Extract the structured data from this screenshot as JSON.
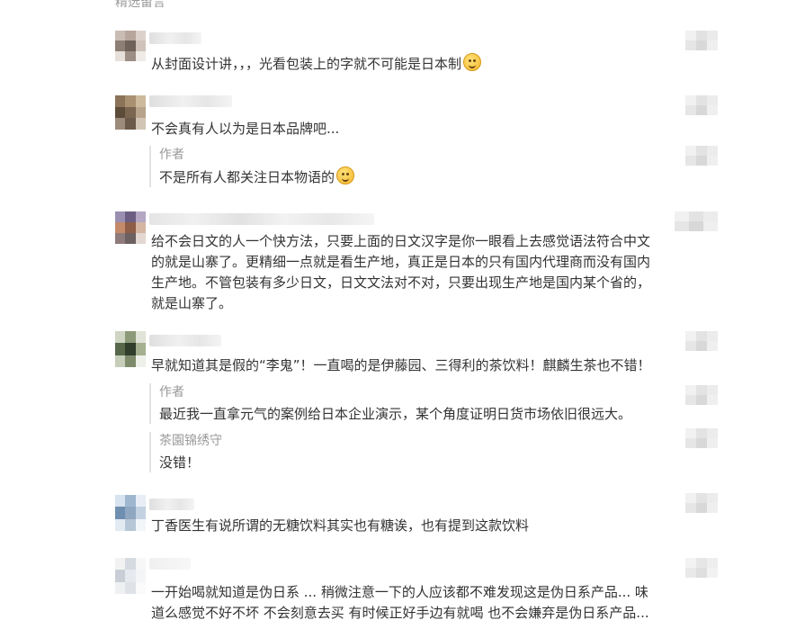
{
  "section": {
    "title": "精选留言"
  },
  "comments": [
    {
      "text": "从封面设计讲，，，光看包装上的字就不可能是日本制",
      "emoji": "smile-icon",
      "replies": []
    },
    {
      "text": "不会真有人以为是日本品牌吧...",
      "replies": [
        {
          "author": "作者",
          "text": "不是所有人都关注日本物语的",
          "emoji": "smile-icon"
        }
      ]
    },
    {
      "text": "给不会日文的人一个快方法，只要上面的日文汉字是你一眼看上去感觉语法符合中文\n的就是山寨了。更精细一点就是看生产地，真正是日本的只有国内代理商而没有国内\n生产地。不管包装有多少日文，日文文法对不对，只要出现生产地是国内某个省的，\n就是山寨了。",
      "replies": []
    },
    {
      "text": "早就知道其是假的“李鬼”！一直喝的是伊藤园、三得利的茶饮料！麒麟生茶也不错！",
      "replies": [
        {
          "author": "作者",
          "text": "最近我一直拿元气的案例给日本企业演示，某个角度证明日货市场依旧很远大。"
        },
        {
          "author": "茶園锦绣守",
          "text": "没错！"
        }
      ]
    },
    {
      "text": "丁香医生有说所谓的无糖饮料其实也有糖诶，也有提到这款饮料",
      "replies": []
    },
    {
      "text": "一开始喝就知道是伪日系 ... 稍微注意一下的人应该都不难发现这是伪日系产品... 味\n道么感觉不好不坏 不会刻意去买 有时候正好手边有就喝 也不会嫌弃是伪日系产品...",
      "replies": []
    }
  ]
}
